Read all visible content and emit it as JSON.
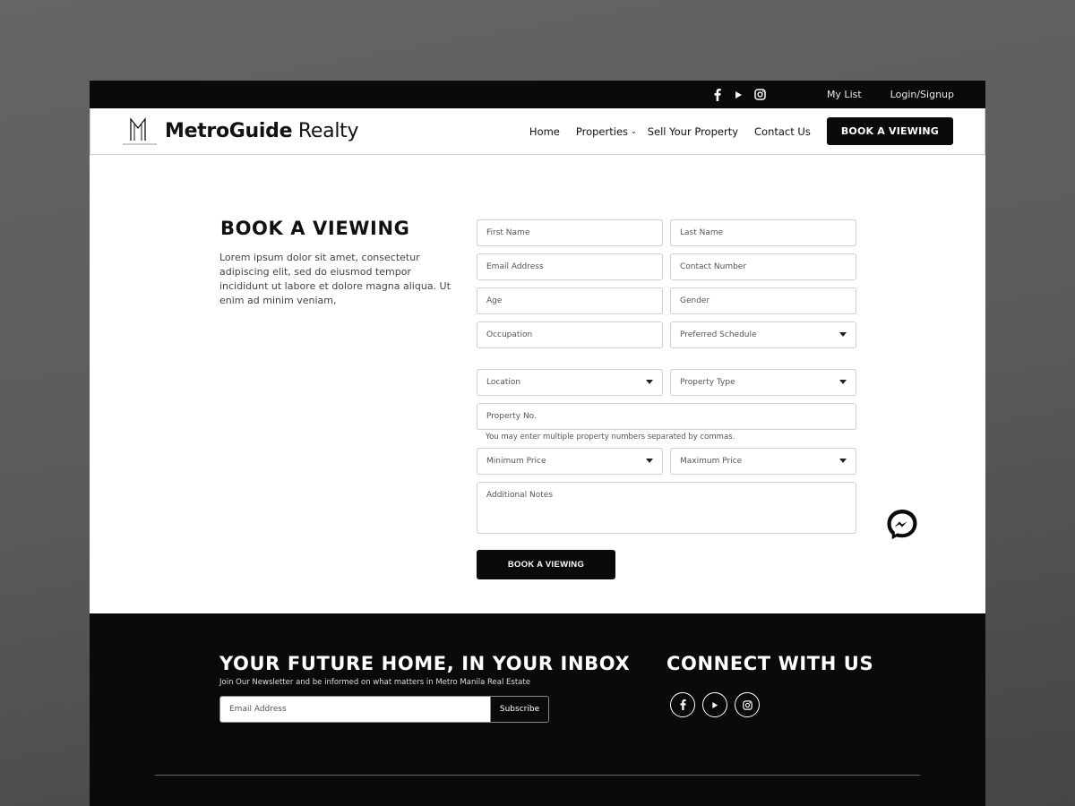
{
  "topbar": {
    "social_icons": [
      "facebook-icon",
      "youtube-icon",
      "instagram-icon"
    ],
    "links": [
      "My List",
      "Login/Signup"
    ]
  },
  "header": {
    "brand_bold": "MetroGuide",
    "brand_light": " Realty",
    "nav": [
      {
        "label": "Home",
        "has_dropdown": false
      },
      {
        "label": "Properties",
        "has_dropdown": true
      },
      {
        "label": "Sell Your Property",
        "has_dropdown": false
      },
      {
        "label": "Contact Us",
        "has_dropdown": false
      }
    ],
    "cta_label": "BOOK A VIEWING"
  },
  "main": {
    "title": "BOOK A VIEWING",
    "description": "Lorem ipsum dolor sit amet, consectetur adipiscing elit, sed do eiusmod tempor incididunt ut labore et dolore magna aliqua. Ut enim ad minim veniam,",
    "form": {
      "first_name": {
        "placeholder": "First Name",
        "value": ""
      },
      "last_name": {
        "placeholder": "Last Name",
        "value": ""
      },
      "email": {
        "placeholder": "Email Address",
        "value": ""
      },
      "contact_number": {
        "placeholder": "Contact Number",
        "value": ""
      },
      "age": {
        "placeholder": "Age",
        "value": ""
      },
      "gender": {
        "placeholder": "Gender",
        "value": ""
      },
      "occupation": {
        "placeholder": "Occupation",
        "value": ""
      },
      "preferred_schedule": {
        "selected": "Preferred Schedule"
      },
      "location": {
        "selected": "Location"
      },
      "property_type": {
        "selected": "Property Type"
      },
      "property_no": {
        "placeholder": "Property No.",
        "value": ""
      },
      "property_no_hint": "You may enter multiple property numbers separated by commas.",
      "minimum_price": {
        "selected": "Minimum Price"
      },
      "maximum_price": {
        "selected": "Maximum Price"
      },
      "additional_notes": {
        "placeholder": "Additional Notes",
        "value": ""
      },
      "submit_label": "BOOK A VIEWING"
    },
    "chat_icon": "messenger-icon"
  },
  "footer": {
    "newsletter_title": "YOUR FUTURE HOME, IN YOUR INBOX",
    "newsletter_subtitle": "Join Our Newsletter and be informed on what matters in Metro Manila Real Estate",
    "email_placeholder": "Email Address",
    "subscribe_label": "Subscribe",
    "connect_title": "CONNECT WITH US",
    "social_icons": [
      "facebook-icon",
      "youtube-icon",
      "instagram-icon"
    ]
  }
}
